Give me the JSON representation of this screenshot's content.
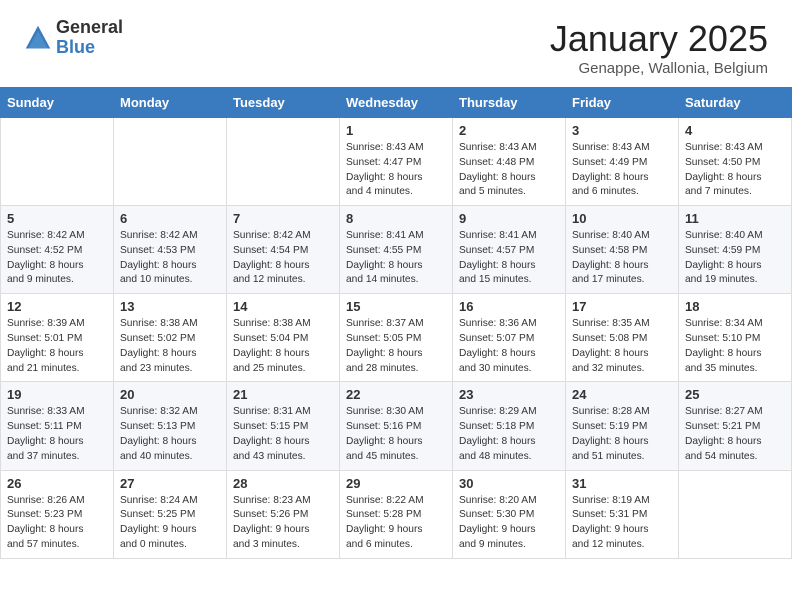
{
  "header": {
    "logo_general": "General",
    "logo_blue": "Blue",
    "month_title": "January 2025",
    "location": "Genappe, Wallonia, Belgium"
  },
  "days_of_week": [
    "Sunday",
    "Monday",
    "Tuesday",
    "Wednesday",
    "Thursday",
    "Friday",
    "Saturday"
  ],
  "weeks": [
    [
      {
        "day": "",
        "info": ""
      },
      {
        "day": "",
        "info": ""
      },
      {
        "day": "",
        "info": ""
      },
      {
        "day": "1",
        "info": "Sunrise: 8:43 AM\nSunset: 4:47 PM\nDaylight: 8 hours\nand 4 minutes."
      },
      {
        "day": "2",
        "info": "Sunrise: 8:43 AM\nSunset: 4:48 PM\nDaylight: 8 hours\nand 5 minutes."
      },
      {
        "day": "3",
        "info": "Sunrise: 8:43 AM\nSunset: 4:49 PM\nDaylight: 8 hours\nand 6 minutes."
      },
      {
        "day": "4",
        "info": "Sunrise: 8:43 AM\nSunset: 4:50 PM\nDaylight: 8 hours\nand 7 minutes."
      }
    ],
    [
      {
        "day": "5",
        "info": "Sunrise: 8:42 AM\nSunset: 4:52 PM\nDaylight: 8 hours\nand 9 minutes."
      },
      {
        "day": "6",
        "info": "Sunrise: 8:42 AM\nSunset: 4:53 PM\nDaylight: 8 hours\nand 10 minutes."
      },
      {
        "day": "7",
        "info": "Sunrise: 8:42 AM\nSunset: 4:54 PM\nDaylight: 8 hours\nand 12 minutes."
      },
      {
        "day": "8",
        "info": "Sunrise: 8:41 AM\nSunset: 4:55 PM\nDaylight: 8 hours\nand 14 minutes."
      },
      {
        "day": "9",
        "info": "Sunrise: 8:41 AM\nSunset: 4:57 PM\nDaylight: 8 hours\nand 15 minutes."
      },
      {
        "day": "10",
        "info": "Sunrise: 8:40 AM\nSunset: 4:58 PM\nDaylight: 8 hours\nand 17 minutes."
      },
      {
        "day": "11",
        "info": "Sunrise: 8:40 AM\nSunset: 4:59 PM\nDaylight: 8 hours\nand 19 minutes."
      }
    ],
    [
      {
        "day": "12",
        "info": "Sunrise: 8:39 AM\nSunset: 5:01 PM\nDaylight: 8 hours\nand 21 minutes."
      },
      {
        "day": "13",
        "info": "Sunrise: 8:38 AM\nSunset: 5:02 PM\nDaylight: 8 hours\nand 23 minutes."
      },
      {
        "day": "14",
        "info": "Sunrise: 8:38 AM\nSunset: 5:04 PM\nDaylight: 8 hours\nand 25 minutes."
      },
      {
        "day": "15",
        "info": "Sunrise: 8:37 AM\nSunset: 5:05 PM\nDaylight: 8 hours\nand 28 minutes."
      },
      {
        "day": "16",
        "info": "Sunrise: 8:36 AM\nSunset: 5:07 PM\nDaylight: 8 hours\nand 30 minutes."
      },
      {
        "day": "17",
        "info": "Sunrise: 8:35 AM\nSunset: 5:08 PM\nDaylight: 8 hours\nand 32 minutes."
      },
      {
        "day": "18",
        "info": "Sunrise: 8:34 AM\nSunset: 5:10 PM\nDaylight: 8 hours\nand 35 minutes."
      }
    ],
    [
      {
        "day": "19",
        "info": "Sunrise: 8:33 AM\nSunset: 5:11 PM\nDaylight: 8 hours\nand 37 minutes."
      },
      {
        "day": "20",
        "info": "Sunrise: 8:32 AM\nSunset: 5:13 PM\nDaylight: 8 hours\nand 40 minutes."
      },
      {
        "day": "21",
        "info": "Sunrise: 8:31 AM\nSunset: 5:15 PM\nDaylight: 8 hours\nand 43 minutes."
      },
      {
        "day": "22",
        "info": "Sunrise: 8:30 AM\nSunset: 5:16 PM\nDaylight: 8 hours\nand 45 minutes."
      },
      {
        "day": "23",
        "info": "Sunrise: 8:29 AM\nSunset: 5:18 PM\nDaylight: 8 hours\nand 48 minutes."
      },
      {
        "day": "24",
        "info": "Sunrise: 8:28 AM\nSunset: 5:19 PM\nDaylight: 8 hours\nand 51 minutes."
      },
      {
        "day": "25",
        "info": "Sunrise: 8:27 AM\nSunset: 5:21 PM\nDaylight: 8 hours\nand 54 minutes."
      }
    ],
    [
      {
        "day": "26",
        "info": "Sunrise: 8:26 AM\nSunset: 5:23 PM\nDaylight: 8 hours\nand 57 minutes."
      },
      {
        "day": "27",
        "info": "Sunrise: 8:24 AM\nSunset: 5:25 PM\nDaylight: 9 hours\nand 0 minutes."
      },
      {
        "day": "28",
        "info": "Sunrise: 8:23 AM\nSunset: 5:26 PM\nDaylight: 9 hours\nand 3 minutes."
      },
      {
        "day": "29",
        "info": "Sunrise: 8:22 AM\nSunset: 5:28 PM\nDaylight: 9 hours\nand 6 minutes."
      },
      {
        "day": "30",
        "info": "Sunrise: 8:20 AM\nSunset: 5:30 PM\nDaylight: 9 hours\nand 9 minutes."
      },
      {
        "day": "31",
        "info": "Sunrise: 8:19 AM\nSunset: 5:31 PM\nDaylight: 9 hours\nand 12 minutes."
      },
      {
        "day": "",
        "info": ""
      }
    ]
  ]
}
